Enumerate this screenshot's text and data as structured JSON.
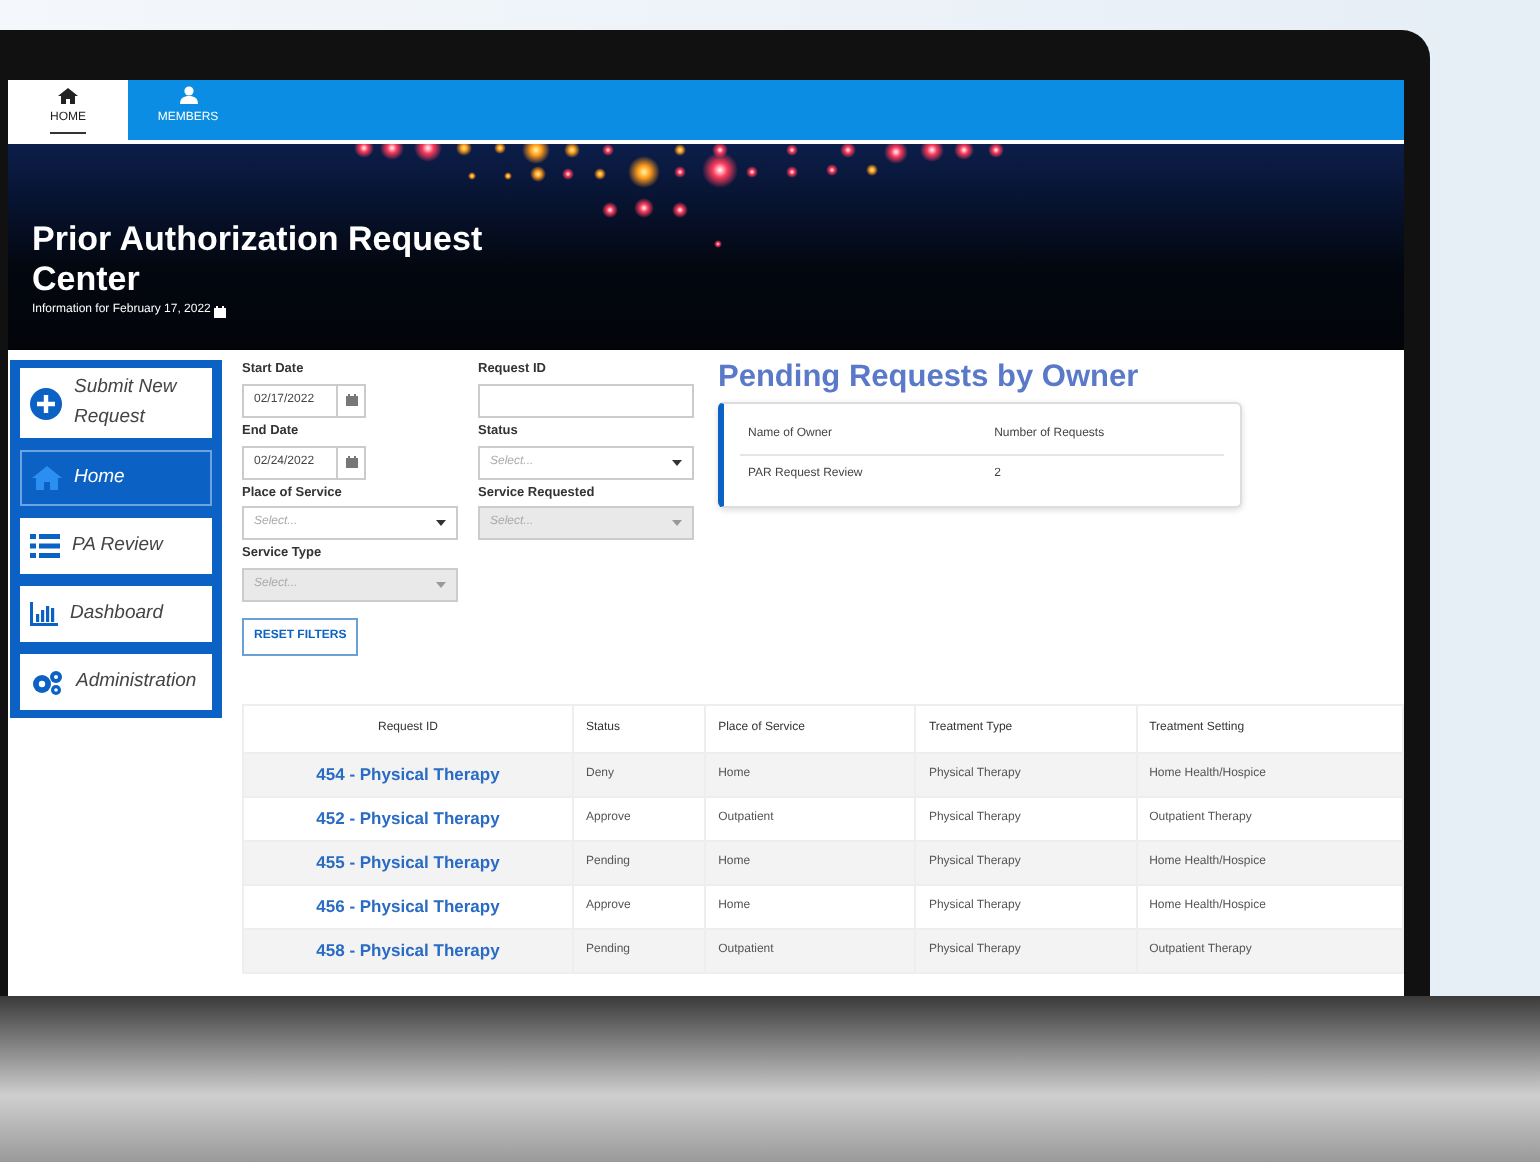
{
  "nav_tabs": [
    {
      "label": "HOME",
      "selected": true
    },
    {
      "label": "MEMBERS",
      "selected": false
    }
  ],
  "banner": {
    "title": "Prior Authorization Request Center",
    "subtitle": "Information for February 17, 2022"
  },
  "sidebar": {
    "items": [
      {
        "label": "Submit New Request",
        "kind": "action",
        "selected": false
      },
      {
        "label": "Home",
        "kind": "link",
        "selected": true
      },
      {
        "label": "PA Review",
        "kind": "link",
        "selected": false
      },
      {
        "label": "Dashboard",
        "kind": "link",
        "selected": false
      },
      {
        "label": "Administration",
        "kind": "link",
        "selected": false
      }
    ]
  },
  "filters": [
    {
      "label": "Start Date",
      "kind": "date",
      "value": "02/17/2022",
      "disabled": false
    },
    {
      "label": "Request ID",
      "kind": "text",
      "disabled": false
    },
    {
      "label": "End Date",
      "kind": "date",
      "value": "02/24/2022",
      "disabled": false
    },
    {
      "label": "Status",
      "kind": "select",
      "placeholder": "Select...",
      "disabled": false
    },
    {
      "label": "Place of Service",
      "kind": "select",
      "placeholder": "Select...",
      "disabled": false
    },
    {
      "label": "Service Requested",
      "kind": "select",
      "placeholder": "Select...",
      "disabled": true
    },
    {
      "label": "Service Type",
      "kind": "select",
      "placeholder": "Select...",
      "disabled": true
    }
  ],
  "reset_button": "RESET FILTERS",
  "pending": {
    "title": "Pending Requests by Owner",
    "columns": [
      "Name of Owner",
      "Number of Requests"
    ],
    "rows": [
      [
        "PAR Request Review",
        "2"
      ]
    ]
  },
  "table": {
    "columns": [
      "Request ID",
      "Status",
      "Place of Service",
      "Treatment Type",
      "Treatment Setting"
    ],
    "rows": [
      [
        "454 - Physical Therapy",
        "Deny",
        "Home",
        "Physical Therapy",
        "Home Health/Hospice"
      ],
      [
        "452 - Physical Therapy",
        "Approve",
        "Outpatient",
        "Physical Therapy",
        "Outpatient Therapy"
      ],
      [
        "455 - Physical Therapy",
        "Pending",
        "Home",
        "Physical Therapy",
        "Home Health/Hospice"
      ],
      [
        "456 - Physical Therapy",
        "Approve",
        "Home",
        "Physical Therapy",
        "Home Health/Hospice"
      ],
      [
        "458 - Physical Therapy",
        "Pending",
        "Outpatient",
        "Physical Therapy",
        "Outpatient Therapy"
      ]
    ]
  }
}
